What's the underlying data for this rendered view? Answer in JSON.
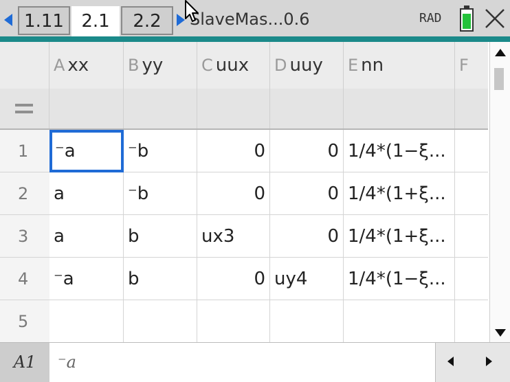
{
  "tabs": [
    {
      "label": "1.11"
    },
    {
      "label": "2.1"
    },
    {
      "label": "2.2"
    }
  ],
  "document_title": "SlaveMas...0.6",
  "angle_mode": "RAD",
  "battery_level": 0.85,
  "colors": {
    "accent": "#1f6bd6",
    "battery": "#23c23a",
    "divider": "#1b8a8a"
  },
  "columns": [
    {
      "letter": "A",
      "name": "xx"
    },
    {
      "letter": "B",
      "name": "yy"
    },
    {
      "letter": "C",
      "name": "uux"
    },
    {
      "letter": "D",
      "name": "uuy"
    },
    {
      "letter": "E",
      "name": "nn"
    },
    {
      "letter": "F",
      "name": ""
    }
  ],
  "rows": [
    {
      "num": "1",
      "cells": [
        "⁻a",
        "⁻b",
        "0",
        "0",
        "1/4*(1−ξ...",
        ""
      ]
    },
    {
      "num": "2",
      "cells": [
        "a",
        "⁻b",
        "0",
        "0",
        "1/4*(1+ξ...",
        ""
      ]
    },
    {
      "num": "3",
      "cells": [
        "a",
        "b",
        "ux3",
        "0",
        "1/4*(1+ξ...",
        ""
      ]
    },
    {
      "num": "4",
      "cells": [
        "⁻a",
        "b",
        "0",
        "uy4",
        "1/4*(1−ξ...",
        ""
      ]
    },
    {
      "num": "5",
      "cells": [
        "",
        "",
        "",
        "",
        "",
        ""
      ]
    }
  ],
  "entry": {
    "cell_ref": "A1",
    "value": "⁻a"
  }
}
